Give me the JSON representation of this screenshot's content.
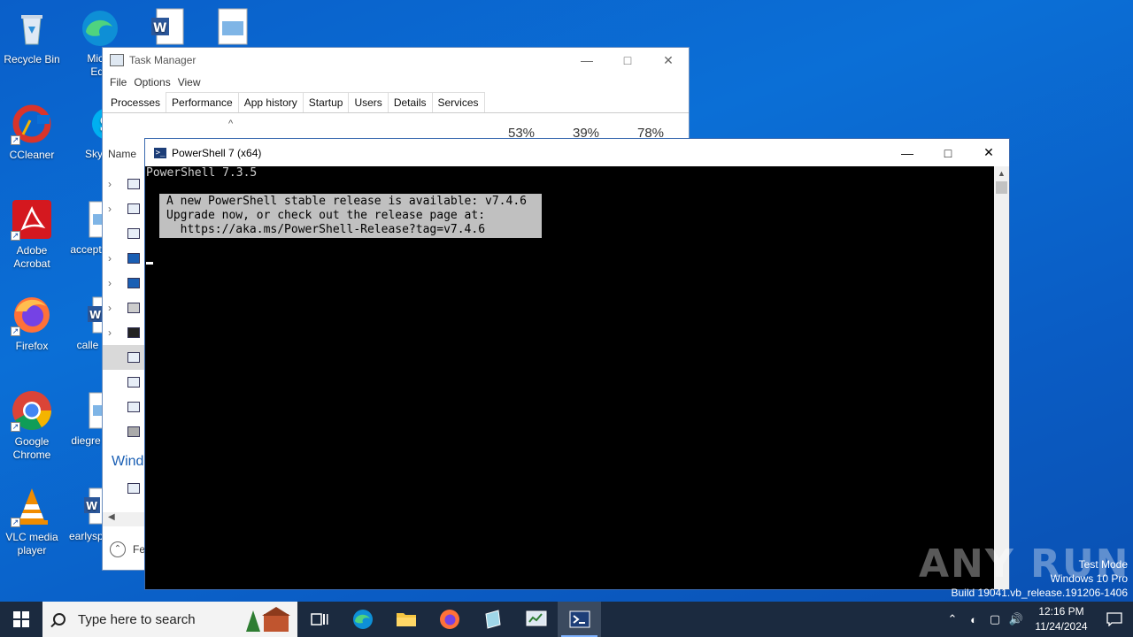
{
  "desktop": {
    "icons": [
      {
        "label": "Recycle Bin"
      },
      {
        "label": "CCleaner"
      },
      {
        "label": "Adobe Acrobat"
      },
      {
        "label": "Firefox"
      },
      {
        "label": "Google Chrome"
      },
      {
        "label": "VLC media player"
      }
    ],
    "partial_icons": [
      {
        "label": "Micro Edg"
      },
      {
        "label": "Sky"
      },
      {
        "label": "accept"
      },
      {
        "label": "calle"
      },
      {
        "label": "diegre"
      },
      {
        "label": "earlysp"
      }
    ]
  },
  "task_manager": {
    "title": "Task Manager",
    "menu": [
      "File",
      "Options",
      "View"
    ],
    "tabs": [
      "Processes",
      "Performance",
      "App history",
      "Startup",
      "Users",
      "Details",
      "Services"
    ],
    "active_tab": "Processes",
    "cpu": "53%",
    "memory": "39%",
    "disk": "78%",
    "name_header": "Name",
    "section": "Wind",
    "fewer_details": "Fev"
  },
  "powershell": {
    "title": "PowerShell 7 (x64)",
    "version_line": "PowerShell 7.3.5",
    "notice": [
      "A new PowerShell stable release is available: v7.4.6",
      "Upgrade now, or check out the release page at:",
      "  https://aka.ms/PowerShell-Release?tag=v7.4.6"
    ]
  },
  "watermark": {
    "brand": "ANY RUN",
    "line1": "Test Mode",
    "line2": "Windows 10 Pro",
    "line3": "Build 19041.vb_release.191206-1406"
  },
  "taskbar": {
    "search_placeholder": "Type here to search",
    "time": "12:16 PM",
    "date": "11/24/2024"
  },
  "colors": {
    "desktop": "#0b6fd6",
    "taskbar": "#1b2a3f",
    "console_bg": "#000000",
    "notice_bg": "#c0c0c0"
  }
}
